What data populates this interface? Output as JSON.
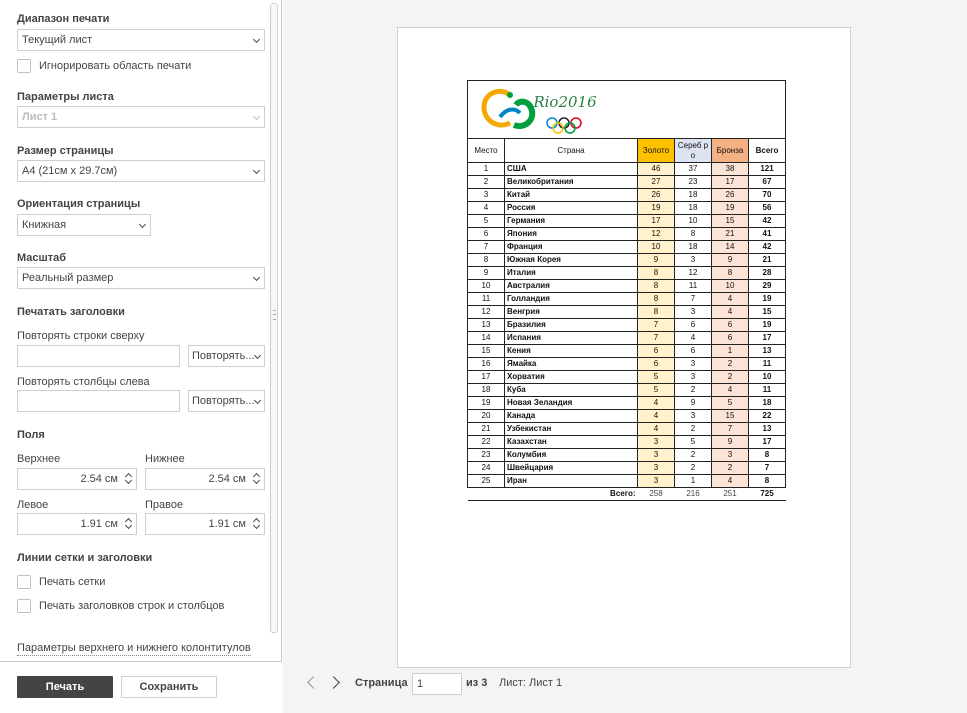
{
  "print_range": {
    "title": "Диапазон печати",
    "selected": "Текущий лист",
    "ignore_print_area_label": "Игнорировать область печати"
  },
  "sheet_params": {
    "title": "Параметры листа",
    "selected": "Лист  1"
  },
  "page_size": {
    "title": "Размер страницы",
    "selected": "A4 (21см x 29.7см)"
  },
  "orientation": {
    "title": "Ориентация страницы",
    "selected": "Книжная"
  },
  "scale": {
    "title": "Масштаб",
    "selected": "Реальный размер"
  },
  "print_titles": {
    "title": "Печатать заголовки",
    "repeat_rows_label": "Повторять строки сверху",
    "repeat_rows_value": "",
    "repeat_rows_button": "Повторять...",
    "repeat_cols_label": "Повторять столбцы слева",
    "repeat_cols_value": "",
    "repeat_cols_button": "Повторять..."
  },
  "margins": {
    "title": "Поля",
    "top_label": "Верхнее",
    "top_value": "2.54 см",
    "bottom_label": "Нижнее",
    "bottom_value": "2.54 см",
    "left_label": "Левое",
    "left_value": "1.91 см",
    "right_label": "Правое",
    "right_value": "1.91 см"
  },
  "gridlines": {
    "title": "Линии сетки и заголовки",
    "print_grid_label": "Печать сетки",
    "print_headings_label": "Печать заголовков строк и столбцов"
  },
  "header_footer_link": "Параметры верхнего и нижнего колонтитулов",
  "buttons": {
    "print": "Печать",
    "save": "Сохранить"
  },
  "pager": {
    "page_label": "Страница",
    "current_page": "1",
    "of_label": "из 3",
    "sheet_info": "Лист: Лист  1"
  },
  "preview": {
    "logo_text": "Rio2016",
    "logo_ring_colors": [
      "#0085c7",
      "#222222",
      "#df0024",
      "#f4c300",
      "#009f3d"
    ],
    "headers": {
      "place": "Место",
      "country": "Страна",
      "gold": "Золото",
      "silver": "Сереб ро",
      "bronze": "Бронза",
      "total": "Всего"
    },
    "rows": [
      {
        "place": "1",
        "country": "США",
        "gold": "46",
        "silver": "37",
        "bronze": "38",
        "total": "121"
      },
      {
        "place": "2",
        "country": "Великобритания",
        "gold": "27",
        "silver": "23",
        "bronze": "17",
        "total": "67"
      },
      {
        "place": "3",
        "country": "Китай",
        "gold": "26",
        "silver": "18",
        "bronze": "26",
        "total": "70"
      },
      {
        "place": "4",
        "country": "Россия",
        "gold": "19",
        "silver": "18",
        "bronze": "19",
        "total": "56"
      },
      {
        "place": "5",
        "country": "Германия",
        "gold": "17",
        "silver": "10",
        "bronze": "15",
        "total": "42"
      },
      {
        "place": "6",
        "country": "Япония",
        "gold": "12",
        "silver": "8",
        "bronze": "21",
        "total": "41"
      },
      {
        "place": "7",
        "country": "Франция",
        "gold": "10",
        "silver": "18",
        "bronze": "14",
        "total": "42"
      },
      {
        "place": "8",
        "country": "Южная Корея",
        "gold": "9",
        "silver": "3",
        "bronze": "9",
        "total": "21"
      },
      {
        "place": "9",
        "country": "Италия",
        "gold": "8",
        "silver": "12",
        "bronze": "8",
        "total": "28"
      },
      {
        "place": "10",
        "country": "Австралия",
        "gold": "8",
        "silver": "11",
        "bronze": "10",
        "total": "29"
      },
      {
        "place": "11",
        "country": "Голландия",
        "gold": "8",
        "silver": "7",
        "bronze": "4",
        "total": "19"
      },
      {
        "place": "12",
        "country": "Венгрия",
        "gold": "8",
        "silver": "3",
        "bronze": "4",
        "total": "15"
      },
      {
        "place": "13",
        "country": "Бразилия",
        "gold": "7",
        "silver": "6",
        "bronze": "6",
        "total": "19"
      },
      {
        "place": "14",
        "country": "Испания",
        "gold": "7",
        "silver": "4",
        "bronze": "6",
        "total": "17"
      },
      {
        "place": "15",
        "country": "Кения",
        "gold": "6",
        "silver": "6",
        "bronze": "1",
        "total": "13"
      },
      {
        "place": "16",
        "country": "Ямайка",
        "gold": "6",
        "silver": "3",
        "bronze": "2",
        "total": "11"
      },
      {
        "place": "17",
        "country": "Хорватия",
        "gold": "5",
        "silver": "3",
        "bronze": "2",
        "total": "10"
      },
      {
        "place": "18",
        "country": "Куба",
        "gold": "5",
        "silver": "2",
        "bronze": "4",
        "total": "11"
      },
      {
        "place": "19",
        "country": "Новая Зеландия",
        "gold": "4",
        "silver": "9",
        "bronze": "5",
        "total": "18"
      },
      {
        "place": "20",
        "country": "Канада",
        "gold": "4",
        "silver": "3",
        "bronze": "15",
        "total": "22"
      },
      {
        "place": "21",
        "country": "Узбекистан",
        "gold": "4",
        "silver": "2",
        "bronze": "7",
        "total": "13"
      },
      {
        "place": "22",
        "country": "Казахстан",
        "gold": "3",
        "silver": "5",
        "bronze": "9",
        "total": "17"
      },
      {
        "place": "23",
        "country": "Колумбия",
        "gold": "3",
        "silver": "2",
        "bronze": "3",
        "total": "8"
      },
      {
        "place": "24",
        "country": "Швейцария",
        "gold": "3",
        "silver": "2",
        "bronze": "2",
        "total": "7"
      },
      {
        "place": "25",
        "country": "Иран",
        "gold": "3",
        "silver": "1",
        "bronze": "4",
        "total": "8"
      }
    ],
    "summary": {
      "label": "Всего:",
      "gold": "258",
      "silver": "216",
      "bronze": "251",
      "total": "725"
    }
  }
}
